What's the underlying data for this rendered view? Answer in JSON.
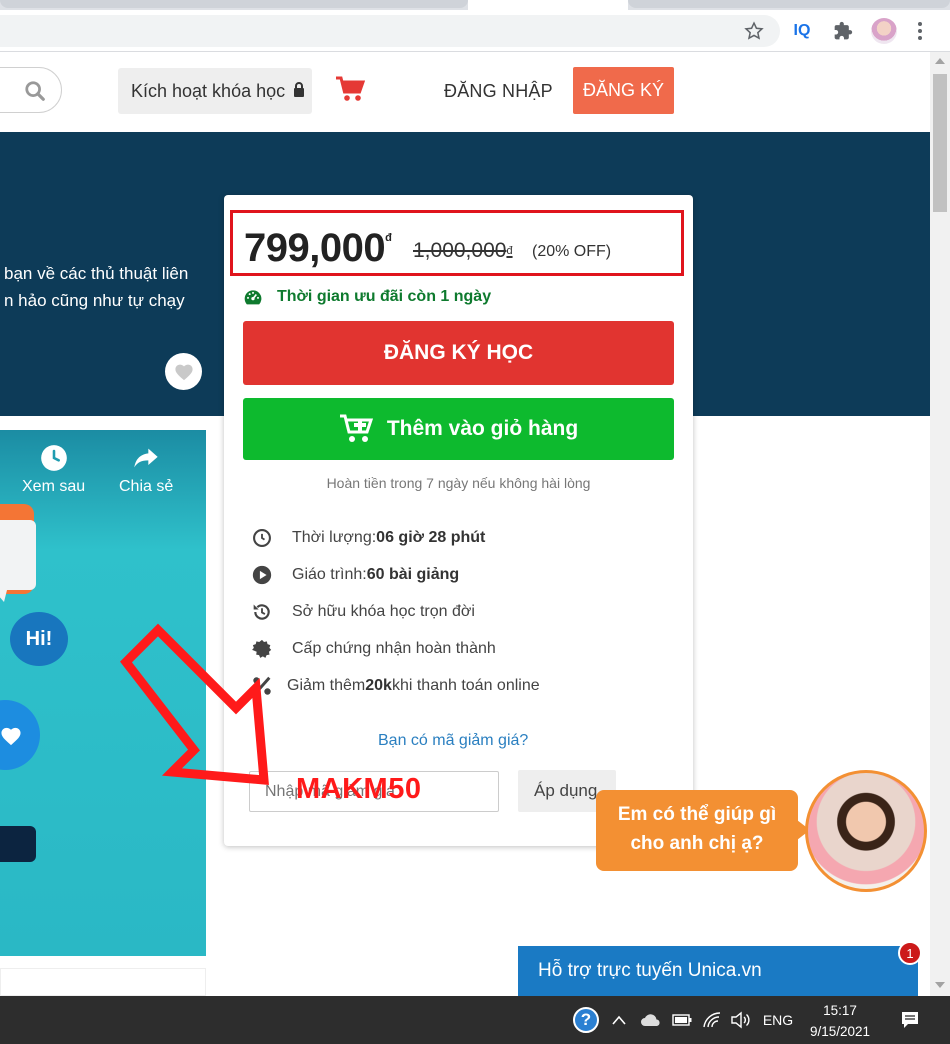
{
  "header": {
    "activate_label": "Kích hoạt khóa học",
    "login_label": "ĐĂNG NHẬP",
    "signup_label": "ĐĂNG KÝ"
  },
  "banner": {
    "line1": "bạn về các thủ thuật liên",
    "line2": "n hảo cũng như tự chạy"
  },
  "video": {
    "watch_later": "Xem sau",
    "share": "Chia sẻ",
    "hi": "Hi!"
  },
  "price_card": {
    "price": "799,000",
    "currency": "đ",
    "old_price": "1,000,000",
    "discount": "(20% OFF)",
    "countdown": "Thời gian ưu đãi còn 1 ngày",
    "enroll_label": "ĐĂNG KÝ HỌC",
    "add_cart_label": "Thêm vào giỏ hàng",
    "refund_note": "Hoàn tiền trong 7 ngày nếu không hài lòng",
    "features": [
      {
        "label": "Thời lượng: ",
        "value": "06 giờ 28 phút",
        "icon": "clock-icon"
      },
      {
        "label": "Giáo trình: ",
        "value": "60 bài giảng",
        "icon": "play-circle-icon"
      },
      {
        "label": "Sở hữu khóa học trọn đời",
        "value": "",
        "icon": "history-icon"
      },
      {
        "label": "Cấp chứng nhận hoàn thành",
        "value": "",
        "icon": "certificate-icon"
      },
      {
        "label": "Giảm thêm ",
        "value": "20k",
        "suffix": " khi thanh toán online",
        "icon": "percent-icon"
      }
    ],
    "coupon_link": "Bạn có mã giảm giá?",
    "coupon_placeholder": "Nhập mã giảm giá",
    "apply_label": "Áp dụng",
    "annotation_code": "MAKM50"
  },
  "chat": {
    "bubble_line1": "Em có thể giúp gì",
    "bubble_line2": "cho anh chị ạ?",
    "support_label": "Hỗ trợ trực tuyến Unica.vn",
    "badge": "1"
  },
  "taskbar": {
    "lang": "ENG",
    "time": "15:17",
    "date": "9/15/2021"
  },
  "colors": {
    "brand_dark": "#0d3b58",
    "enroll_red": "#e13430",
    "cart_green": "#0dba2e",
    "signup_orange": "#f06a4b",
    "annotation_red": "#e0141c"
  }
}
